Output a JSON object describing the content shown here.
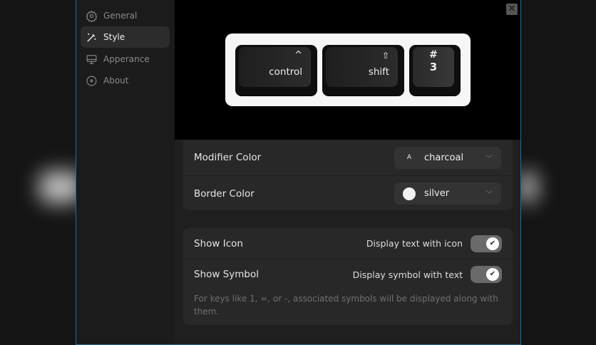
{
  "sidebar": {
    "items": [
      {
        "label": "General",
        "icon": "gear-icon"
      },
      {
        "label": "Style",
        "icon": "magic-wand-icon"
      },
      {
        "label": "Apperance",
        "icon": "monitor-icon"
      },
      {
        "label": "About",
        "icon": "info-circle-icon"
      }
    ],
    "active": "Style"
  },
  "preview": {
    "keys": [
      {
        "symbol": "^",
        "label": "control"
      },
      {
        "symbol": "⇧",
        "label": "shift"
      },
      {
        "symbol": "#",
        "label": "3"
      }
    ]
  },
  "colors": {
    "modifier_label": "Modifier Color",
    "modifier_value": "charcoal",
    "modifier_prefix": "A",
    "border_label": "Border Color",
    "border_value": "silver",
    "border_swatch": "#f2f2f2",
    "accent_border": "#2e6a8e"
  },
  "options": {
    "show_icon_label": "Show Icon",
    "show_icon_desc": "Display text with icon",
    "show_icon_on": true,
    "show_symbol_label": "Show Symbol",
    "show_symbol_desc": "Display symbol with text",
    "show_symbol_on": true,
    "note": "For keys like 1, =, or -, associated symbols will be displayed along with them."
  },
  "close_label": "✕"
}
